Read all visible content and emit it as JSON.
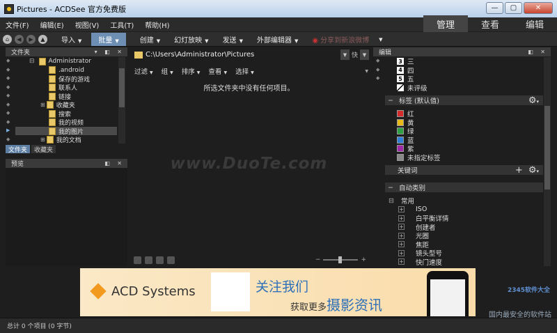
{
  "window": {
    "title": "Pictures - ACDSee 官方免费版"
  },
  "menu": [
    "文件(F)",
    "编辑(E)",
    "视图(V)",
    "工具(T)",
    "帮助(H)"
  ],
  "modes": [
    {
      "label": "管理",
      "active": true
    },
    {
      "label": "查看",
      "active": false
    },
    {
      "label": "编辑",
      "active": false
    }
  ],
  "toolbar": {
    "buttons": [
      {
        "label": "导入",
        "state": "normal"
      },
      {
        "label": "批量",
        "state": "active"
      },
      {
        "label": "创建",
        "state": "normal"
      },
      {
        "label": "幻灯放映",
        "state": "normal"
      },
      {
        "label": "发送",
        "state": "normal"
      },
      {
        "label": "外部编辑器",
        "state": "normal"
      },
      {
        "label": "分享到新浪微博",
        "state": "disabled"
      }
    ]
  },
  "folders_panel": {
    "title": "文件夹",
    "tree": [
      {
        "label": "Administrator",
        "indent": 0,
        "selected": false
      },
      {
        "label": ".android",
        "indent": 1,
        "selected": false
      },
      {
        "label": "保存的游戏",
        "indent": 1,
        "selected": false
      },
      {
        "label": "联系人",
        "indent": 1,
        "selected": false
      },
      {
        "label": "链接",
        "indent": 1,
        "selected": false
      },
      {
        "label": "收藏夹",
        "indent": 1,
        "selected": false
      },
      {
        "label": "搜索",
        "indent": 1,
        "selected": false
      },
      {
        "label": "我的视频",
        "indent": 1,
        "selected": false
      },
      {
        "label": "我的图片",
        "indent": 1,
        "selected": true
      },
      {
        "label": "我的文档",
        "indent": 1,
        "selected": false
      }
    ],
    "tabs": [
      {
        "label": "文件夹",
        "active": true
      },
      {
        "label": "收藏夹",
        "active": false
      }
    ]
  },
  "preview_panel": {
    "title": "预览"
  },
  "browser": {
    "path": "C:\\Users\\Administrator\\Pictures",
    "quick_label": "快",
    "subbar": [
      "过滤",
      "组",
      "排序",
      "查看",
      "选择"
    ],
    "empty_message": "所选文件夹中没有任何项目。",
    "watermark": "www.DuoTe.com"
  },
  "properties_panel": {
    "title": "编辑",
    "ratings": [
      {
        "num": "3",
        "label": "三"
      },
      {
        "num": "4",
        "label": "四"
      },
      {
        "num": "5",
        "label": "五"
      },
      {
        "num": "",
        "label": "未评级"
      }
    ],
    "labels_section": "标签 (默认值)",
    "labels": [
      {
        "label": "红",
        "color": "#d42b2b"
      },
      {
        "label": "黄",
        "color": "#e8b71a"
      },
      {
        "label": "绿",
        "color": "#2ea043"
      },
      {
        "label": "蓝",
        "color": "#2f7fd6"
      },
      {
        "label": "紫",
        "color": "#a12aa8"
      },
      {
        "label": "未指定标签",
        "color": "#888888"
      }
    ],
    "keywords_section": "关键词",
    "auto_section": "自动类别",
    "auto_group": "常用",
    "auto_items": [
      "ISO",
      "白平衡详情",
      "创建者",
      "光圈",
      "焦距",
      "镜头型号",
      "快门速度"
    ]
  },
  "ad": {
    "brand": "ACD Systems",
    "headline": "关注我们",
    "sub_prefix": "获取更多",
    "sub_big": "摄影资讯"
  },
  "status": {
    "text": "总计 0 个项目 (0 字节)"
  },
  "overlay": {
    "site_badge": "2345软件大全",
    "site_slogan": "国内最安全的软件站"
  }
}
